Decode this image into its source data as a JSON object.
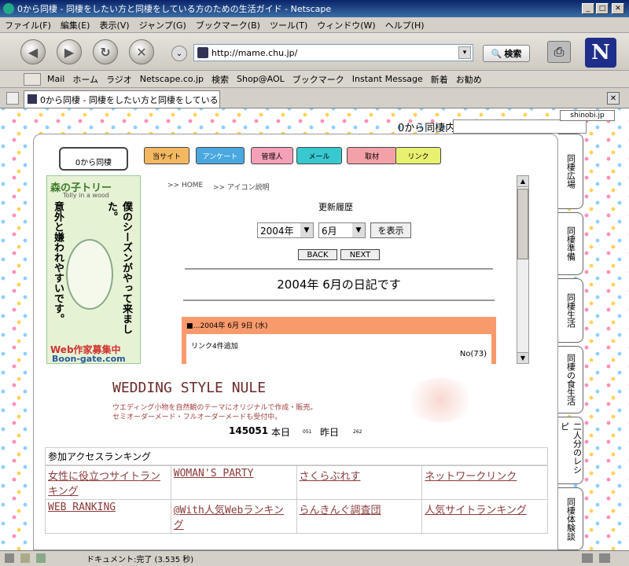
{
  "window": {
    "title": "0から同棲 - 同棲をしたい方と同棲をしている方のための生活ガイド - Netscape"
  },
  "menu": [
    "ファイル(F)",
    "編集(E)",
    "表示(V)",
    "ジャンプ(G)",
    "ブックマーク(B)",
    "ツール(T)",
    "ウィンドウ(W)",
    "ヘルプ(H)"
  ],
  "nav": {
    "url": "http://mame.chu.jp/",
    "search_label": "検索"
  },
  "bookmarks": [
    "Mail",
    "ホーム",
    "ラジオ",
    "Netscape.co.jp",
    "検索",
    "Shop@AOL",
    "ブックマーク",
    "Instant Message",
    "新着",
    "お勧め"
  ],
  "tab": {
    "label": "0から同棲 - 同棲をしたい方と同棲をしている..."
  },
  "page": {
    "shinobi": "shinobi.jp",
    "site_title_scroll": "0から同棲内",
    "logo": "0から同棲",
    "navbtns": [
      "当サイト",
      "アンケート",
      "管理人",
      "メール",
      "取材",
      "リンク"
    ],
    "breadcrumb": [
      ">> HOME",
      ">> アイコン説明"
    ],
    "history_label": "更新履歴",
    "year": "2004年",
    "month": "6月",
    "show_btn": "を表示",
    "back": "BACK",
    "next": "NEXT",
    "diary_title": "2004年 6月の日記です",
    "entry_date": "■…2004年 6月 9日 (水)",
    "entry_text": "リンク4件追加",
    "entry_no": "No(73)",
    "ad": {
      "title1": "森の子トリー",
      "sub": "Tolly in a wood",
      "vertical1": "僕のシーズンがやって来ました。",
      "vertical2": "意外と嫌われやすいです。",
      "recruit": "Web作家募集中",
      "url": "Boon-gate.com"
    },
    "wedding": {
      "title": "WEDDING STYLE NULE",
      "line1": "ウエディング小物を自然観のテーマにオリジナルで作成・販売。",
      "line2": "セミオーダーメード・フルオーダーメードも受付中。"
    },
    "counter": {
      "total": "145051",
      "today_label": "本日",
      "today": "051",
      "yesterday_label": "昨日",
      "yesterday": "262"
    },
    "ranking": {
      "header": "参加アクセスランキング",
      "items": [
        "女性に役立つサイトランキング",
        "WOMAN'S PARTY",
        "さくらぶれす",
        "ネットワークリンク",
        "WEB RANKING",
        "@With人気Webランキング",
        "らんきんぐ調査団",
        "人気サイトランキング"
      ]
    },
    "sidetabs": [
      "同棲広場",
      "同棲準備",
      "同棲生活",
      "同棲の食生活",
      "二人分のレシピ",
      "同棲体験談"
    ]
  },
  "status": {
    "text": "ドキュメント:完了 (3.535 秒)"
  }
}
